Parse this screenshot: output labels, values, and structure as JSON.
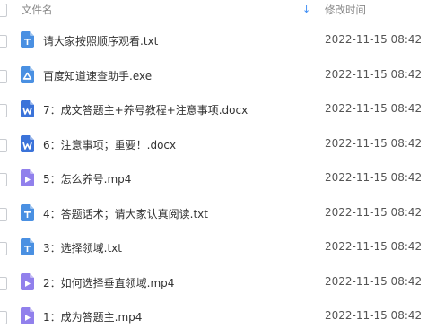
{
  "header": {
    "name_label": "文件名",
    "sort_icon": "arrow-down-icon",
    "time_label": "修改时间"
  },
  "colors": {
    "txt": "#4a90e2",
    "exe": "#4a90e2",
    "doc": "#3b73d9",
    "video": "#9180ec",
    "sort": "#3b8cf5"
  },
  "files": [
    {
      "name": "请大家按照顺序观看.txt",
      "type": "txt",
      "time": "2022-11-15 08:42"
    },
    {
      "name": "百度知道速查助手.exe",
      "type": "exe",
      "time": "2022-11-15 08:42"
    },
    {
      "name": "7：成文答题主+养号教程+注意事项.docx",
      "type": "doc",
      "time": "2022-11-15 08:42"
    },
    {
      "name": "6：注意事项；重要！.docx",
      "type": "doc",
      "time": "2022-11-15 08:42"
    },
    {
      "name": "5：怎么养号.mp4",
      "type": "video",
      "time": "2022-11-15 08:42"
    },
    {
      "name": "4：答题话术；请大家认真阅读.txt",
      "type": "txt",
      "time": "2022-11-15 08:42"
    },
    {
      "name": "3：选择领域.txt",
      "type": "txt",
      "time": "2022-11-15 08:42"
    },
    {
      "name": "2：如何选择垂直领域.mp4",
      "type": "video",
      "time": "2022-11-15 08:42"
    },
    {
      "name": "1：成为答题主.mp4",
      "type": "video",
      "time": "2022-11-15 08:42"
    }
  ]
}
